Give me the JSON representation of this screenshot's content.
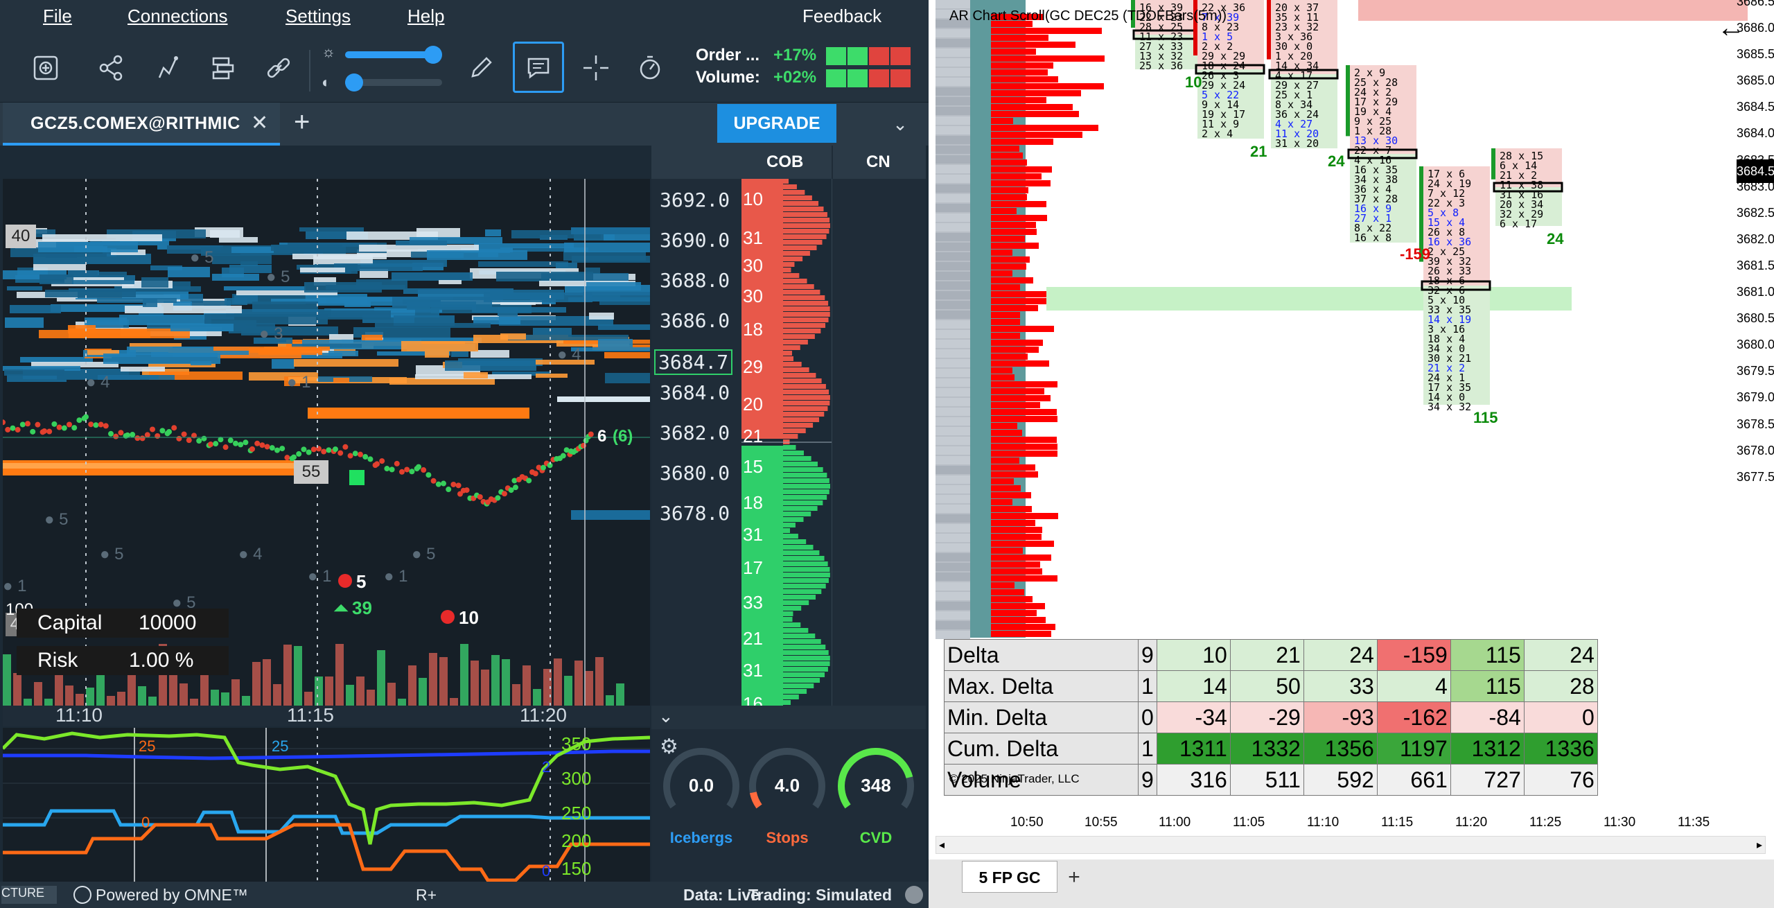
{
  "menu": {
    "file": "File",
    "connections": "Connections",
    "settings": "Settings",
    "help": "Help",
    "feedback": "Feedback"
  },
  "ratios": {
    "order_label": "Order ...",
    "order_value": "+17%",
    "volume_label": "Volume:",
    "volume_value": "+02%",
    "colors": {
      "green": "#3ddc6a",
      "red": "#e0443e"
    }
  },
  "tabs": {
    "active": "GCZ5.COMEX@RITHMIC",
    "upgrade": "UPGRADE"
  },
  "book": {
    "cob_header": "COB",
    "cn_header": "CN",
    "prices": [
      "3692.0",
      "3690.0",
      "3688.0",
      "3686.0",
      "3684.7",
      "3684.0",
      "3682.0",
      "3680.0",
      "3678.0"
    ],
    "current_price": "3684.7",
    "ask_counts": [
      "10",
      "31",
      "30",
      "30",
      "18",
      "29",
      "20",
      "21"
    ],
    "bid_counts": [
      "15",
      "18",
      "31",
      "17",
      "33",
      "21",
      "31",
      "16"
    ]
  },
  "heatmap": {
    "level_badge_top": "40",
    "level_badge_mid": "55",
    "level_badge_low": "46",
    "lbl_100": "100",
    "markers": {
      "sell_5": "5",
      "buy_39": "39",
      "sell_10": "10",
      "last_trade": "6",
      "last_trade_paren": "(6)"
    },
    "faded": [
      "5",
      "5",
      "3",
      "4",
      "1",
      "4",
      "5",
      "5",
      "4",
      "5",
      "1",
      "1",
      "1",
      "5"
    ],
    "capital_label": "Capital",
    "capital_value": "10000",
    "risk_label": "Risk",
    "risk_value": "1.00 %"
  },
  "time_axis": [
    "11:10",
    "11:15",
    "11:20"
  ],
  "lower_pane": {
    "scale": [
      "350",
      "300",
      "250",
      "200",
      "150"
    ],
    "mid_labels": [
      "25",
      "25",
      "0",
      "2",
      "0"
    ]
  },
  "gauges": [
    {
      "value": "0.0",
      "label": "Icebergs",
      "color": "#2d9cf4",
      "level": 0.0
    },
    {
      "value": "4.0",
      "label": "Stops",
      "color": "#ff6a3d",
      "level": 0.1
    },
    {
      "value": "348",
      "label": "CVD",
      "color": "#59e84a",
      "level": 0.8
    }
  ],
  "status": {
    "left": "CTURE",
    "powered": "Powered by OMNE™",
    "rplus": "R+",
    "data": "Data: Live",
    "trading": "Trading: Simulated"
  },
  "right": {
    "title": "AR Chart Scroll(GC DEC25 (TDOFBars(5m))",
    "y_labels": [
      "3686.0",
      "3685.5",
      "3685.0",
      "3684.5",
      "3684.0",
      "3683.5",
      "3683.0",
      "3682.5",
      "3682.0",
      "3681.5",
      "3681.0",
      "3680.5",
      "3680.0",
      "3679.5",
      "3679.0",
      "3678.5",
      "3678.0",
      "3677.5"
    ],
    "top_label": "3686.5",
    "price_marker": "3684.5",
    "x_labels": [
      "10:50",
      "10:55",
      "11:00",
      "11:05",
      "11:10",
      "11:15",
      "11:20",
      "11:25",
      "11:30",
      "11:35"
    ],
    "bar_deltas": [
      "10",
      "21",
      "24",
      "-159",
      "115",
      "24"
    ],
    "stats": [
      {
        "label": "Delta",
        "values": [
          "9",
          "10",
          "21",
          "24",
          "-159",
          "115",
          "24"
        ]
      },
      {
        "label": "Max. Delta",
        "values": [
          "1",
          "14",
          "50",
          "33",
          "4",
          "115",
          "28"
        ]
      },
      {
        "label": "Min. Delta",
        "values": [
          "0",
          "-34",
          "-29",
          "-93",
          "-162",
          "-84",
          "0"
        ]
      },
      {
        "label": "Cum. Delta",
        "values": [
          "1",
          "1311",
          "1332",
          "1356",
          "1197",
          "1312",
          "1336"
        ]
      },
      {
        "label": "Volume",
        "values": [
          "9",
          "316",
          "511",
          "592",
          "661",
          "727",
          "76"
        ]
      }
    ],
    "copyright": "© 2025 NinjaTrader, LLC",
    "tab": "5 FP GC",
    "add_tab": "+",
    "back": "←"
  }
}
